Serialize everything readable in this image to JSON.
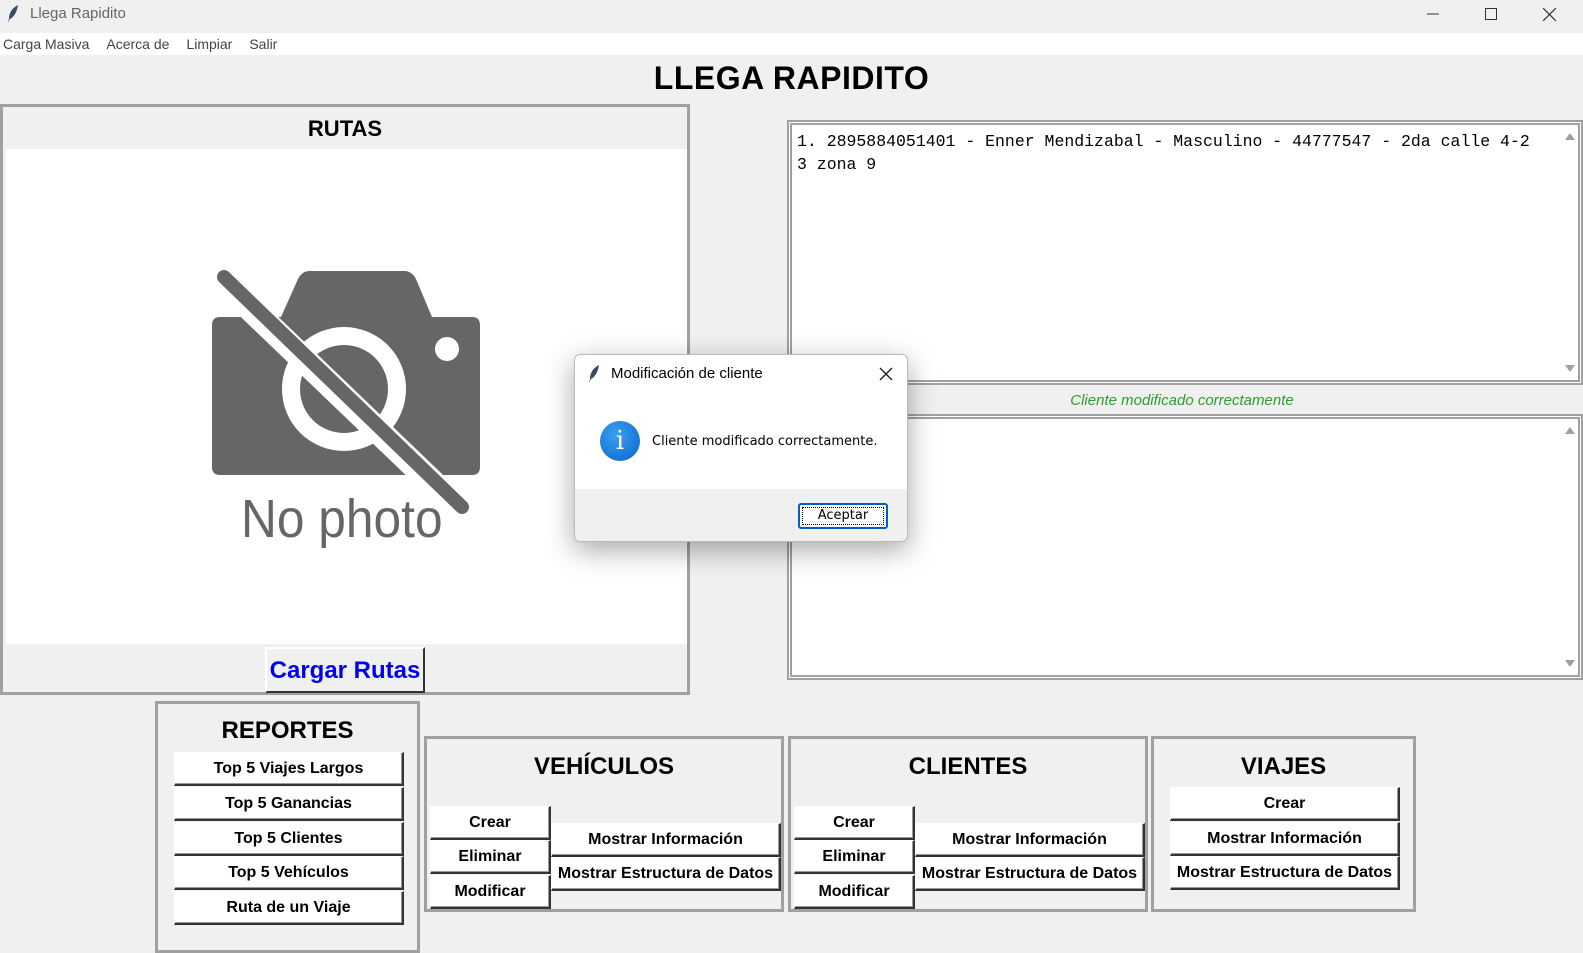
{
  "window": {
    "title": "Llega Rapidito"
  },
  "menu": [
    "Carga Masiva",
    "Acerca de",
    "Limpiar",
    "Salir"
  ],
  "app_title": "LLEGA RAPIDITO",
  "rutas": {
    "title": "RUTAS",
    "placeholder_text": "No photo",
    "button": "Cargar Rutas"
  },
  "output": {
    "text": "1. 2895884051401 - Enner Mendizabal - Masculino - 44777547 - 2da calle 4-23 zona 9",
    "status": "Cliente modificado correctamente",
    "second_text": ""
  },
  "reportes": {
    "title": "REPORTES",
    "buttons": [
      "Top 5 Viajes Largos",
      "Top 5 Ganancias",
      "Top 5 Clientes",
      "Top 5 Vehículos",
      "Ruta de un Viaje"
    ]
  },
  "vehiculos": {
    "title": "VEHÍCULOS",
    "crear": "Crear",
    "eliminar": "Eliminar",
    "modificar": "Modificar",
    "mostrar_info": "Mostrar Información",
    "mostrar_estructura": "Mostrar Estructura de Datos"
  },
  "clientes": {
    "title": "CLIENTES",
    "crear": "Crear",
    "eliminar": "Eliminar",
    "modificar": "Modificar",
    "mostrar_info": "Mostrar Información",
    "mostrar_estructura": "Mostrar Estructura de Datos"
  },
  "viajes": {
    "title": "VIAJES",
    "crear": "Crear",
    "mostrar_info": "Mostrar Información",
    "mostrar_estructura": "Mostrar Estructura de Datos"
  },
  "dialog": {
    "title": "Modificación de cliente",
    "message": "Cliente modificado correctamente.",
    "ok": "Aceptar"
  },
  "colors": {
    "link_blue": "#0000ee",
    "status_green": "#2e9c2e",
    "info_blue": "#0a63c9"
  }
}
